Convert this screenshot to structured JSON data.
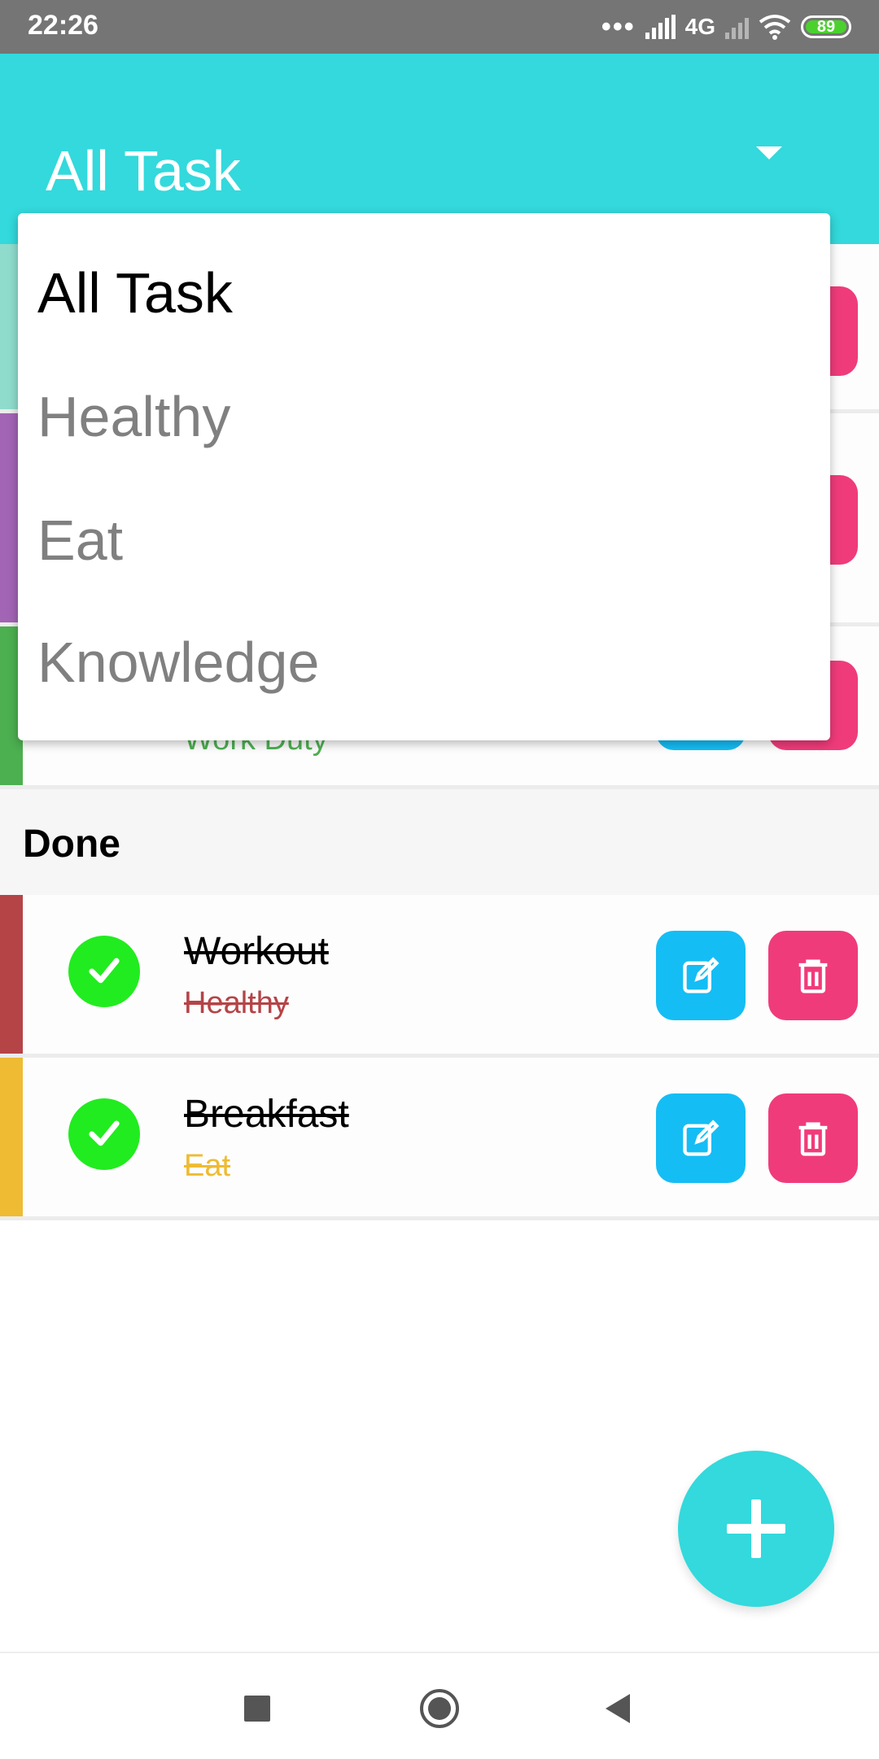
{
  "status_bar": {
    "time": "22:26",
    "dots": "•••",
    "network": "4G",
    "battery": "89"
  },
  "app_bar": {
    "title": "All Task"
  },
  "dropdown": {
    "options": [
      "All Task",
      "Healthy",
      "Eat",
      "Knowledge"
    ],
    "selected": "All Task"
  },
  "background_tasks": [
    {
      "category": "Work Duty",
      "category_color": "#4caf50",
      "stripe_color": "#4caf50"
    }
  ],
  "done_section": {
    "label": "Done",
    "tasks": [
      {
        "name": "Workout",
        "category": "Healthy",
        "category_color": "#b54447",
        "stripe_color": "#b54447"
      },
      {
        "name": "Breakfast",
        "category": "Eat",
        "category_color": "#eebb33",
        "stripe_color": "#eebb33"
      }
    ]
  },
  "colors": {
    "accent": "#33d9dc",
    "edit": "#15bdf5",
    "delete": "#f03b7a",
    "check": "#21ec1f"
  }
}
